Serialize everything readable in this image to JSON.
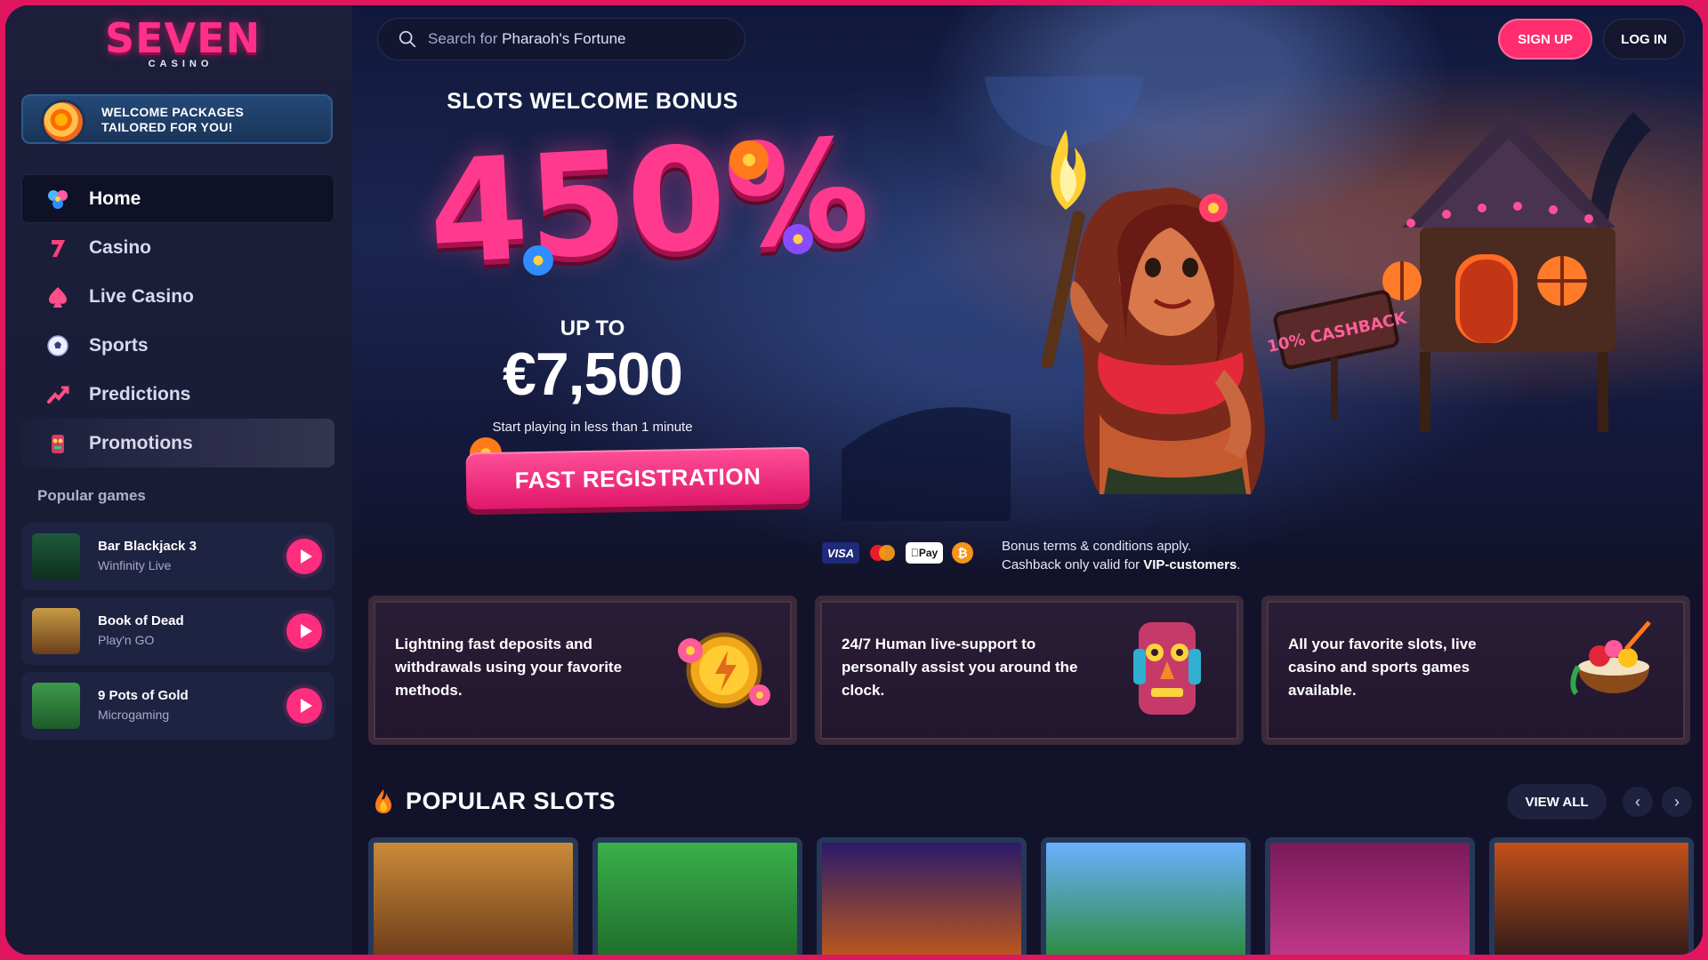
{
  "brand": {
    "logo_main": "SEVEN",
    "logo_sub": "CASINO",
    "accent": "#ff2d7e"
  },
  "welcome": {
    "line1": "WELCOME PACKAGES",
    "line2": "TAILORED FOR YOU!"
  },
  "nav": [
    {
      "label": "Home",
      "icon": "home-icon"
    },
    {
      "label": "Casino",
      "icon": "seven-icon"
    },
    {
      "label": "Live Casino",
      "icon": "chip-icon"
    },
    {
      "label": "Sports",
      "icon": "soccer-ball-icon"
    },
    {
      "label": "Predictions",
      "icon": "trend-icon"
    },
    {
      "label": "Promotions",
      "icon": "totem-icon"
    }
  ],
  "popular_games": {
    "title": "Popular games",
    "items": [
      {
        "name": "Bar Blackjack 3",
        "provider": "Winfinity Live"
      },
      {
        "name": "Book of Dead",
        "provider": "Play'n GO"
      },
      {
        "name": "9 Pots of Gold",
        "provider": "Microgaming"
      }
    ]
  },
  "search": {
    "prefix": "Search for",
    "term": "Pharaoh's Fortune"
  },
  "header": {
    "signup": "SIGN UP",
    "login": "LOG IN"
  },
  "hero": {
    "title": "SLOTS WELCOME BONUS",
    "percent": "450%",
    "upto": "UP TO",
    "amount": "€7,500",
    "subtitle": "Start playing in less than 1 minute",
    "cta": "FAST REGISTRATION",
    "cashback_sign": "10% CASHBACK"
  },
  "payments": {
    "visa": "VISA",
    "applepay": "Pay",
    "btc": "₿"
  },
  "terms": {
    "line1": "Bonus terms & conditions apply.",
    "line2_prefix": "Cashback only valid for ",
    "line2_bold": "VIP-customers",
    "line2_suffix": "."
  },
  "features": [
    {
      "text": "Lightning fast deposits and withdrawals using your favorite methods."
    },
    {
      "text": "24/7 Human live-support to personally assist you around the clock."
    },
    {
      "text": "All your favorite slots, live casino and sports games available."
    }
  ],
  "popular_slots": {
    "title": "POPULAR SLOTS",
    "view_all": "VIEW ALL",
    "prev": "‹",
    "next": "›"
  }
}
